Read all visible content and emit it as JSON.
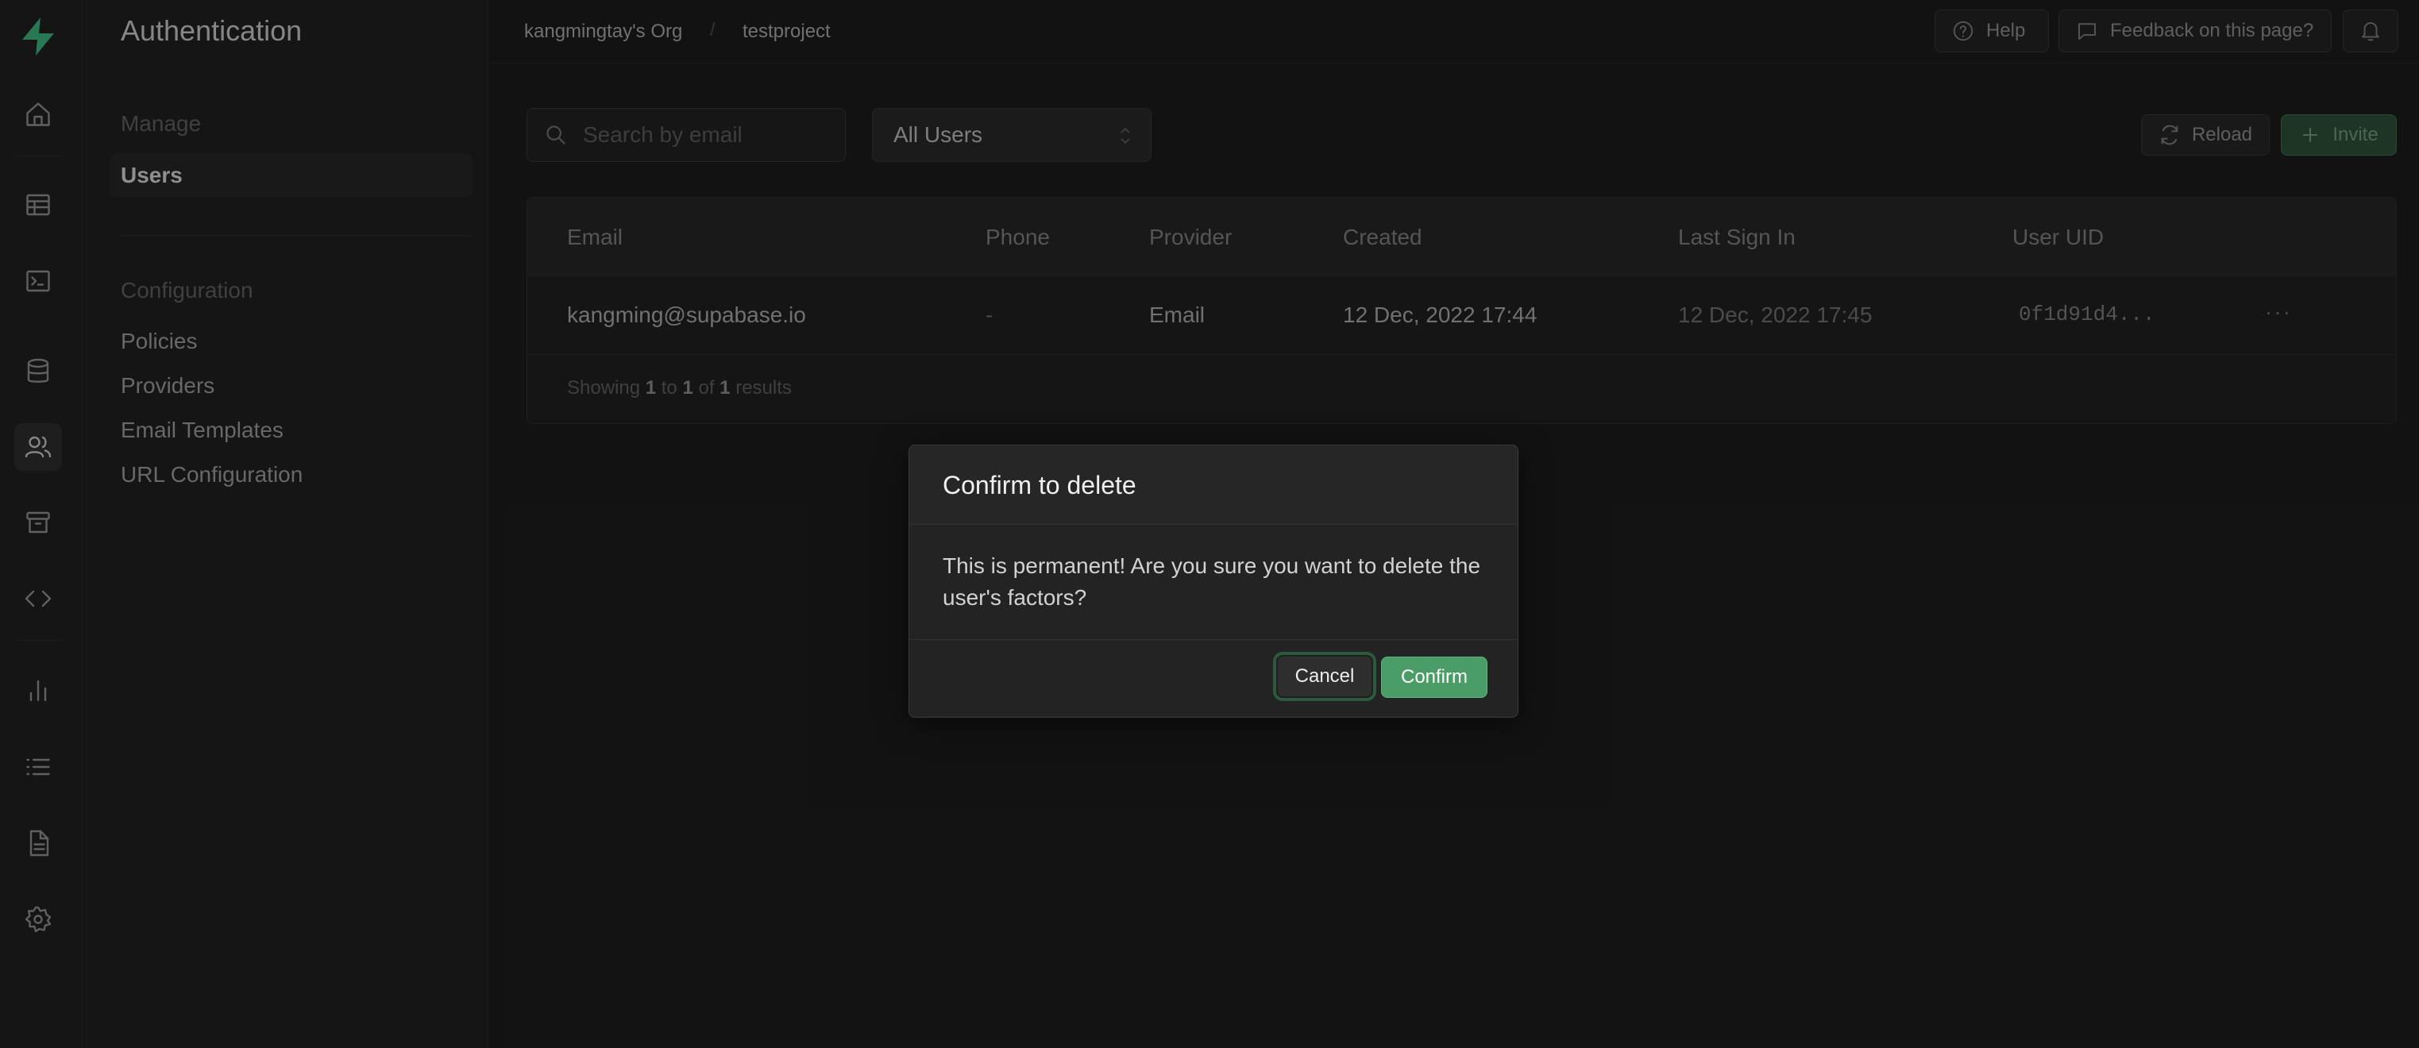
{
  "sidebar": {
    "title": "Authentication",
    "sections": [
      {
        "label": "Manage",
        "items": [
          {
            "label": "Users",
            "active": true
          }
        ]
      },
      {
        "label": "Configuration",
        "items": [
          {
            "label": "Policies"
          },
          {
            "label": "Providers"
          },
          {
            "label": "Email Templates"
          },
          {
            "label": "URL Configuration"
          }
        ]
      }
    ]
  },
  "rail": {
    "icons": [
      "home-icon",
      "table-editor-icon",
      "sql-editor-icon",
      "database-icon",
      "users-icon",
      "storage-icon",
      "api-icon",
      "reports-icon",
      "logs-icon",
      "docs-icon",
      "settings-icon"
    ],
    "active": "users-icon",
    "accent": "#3ecf8e"
  },
  "topbar": {
    "org": "kangmingtay's Org",
    "separator": "/",
    "project": "testproject",
    "help_label": "Help",
    "feedback_label": "Feedback on this page?"
  },
  "toolbar": {
    "search_placeholder": "Search by email",
    "filter_value": "All Users",
    "reload_label": "Reload",
    "invite_label": "Invite"
  },
  "table": {
    "columns": [
      "Email",
      "Phone",
      "Provider",
      "Created",
      "Last Sign In",
      "User UID"
    ],
    "rows": [
      {
        "email": "kangming@supabase.io",
        "phone": "-",
        "provider": "Email",
        "created": "12 Dec, 2022 17:44",
        "last_sign_in": "12 Dec, 2022 17:45",
        "uid": "0f1d91d4...",
        "more": "···"
      }
    ],
    "footer": {
      "prefix": "Showing",
      "from": "1",
      "to_word": "to",
      "to": "1",
      "of_word": "of",
      "total": "1",
      "suffix": "results"
    }
  },
  "modal": {
    "title": "Confirm to delete",
    "body": "This is permanent! Are you sure you want to delete the user's factors?",
    "cancel_label": "Cancel",
    "confirm_label": "Confirm",
    "confirm_color": "#4a9d67"
  }
}
